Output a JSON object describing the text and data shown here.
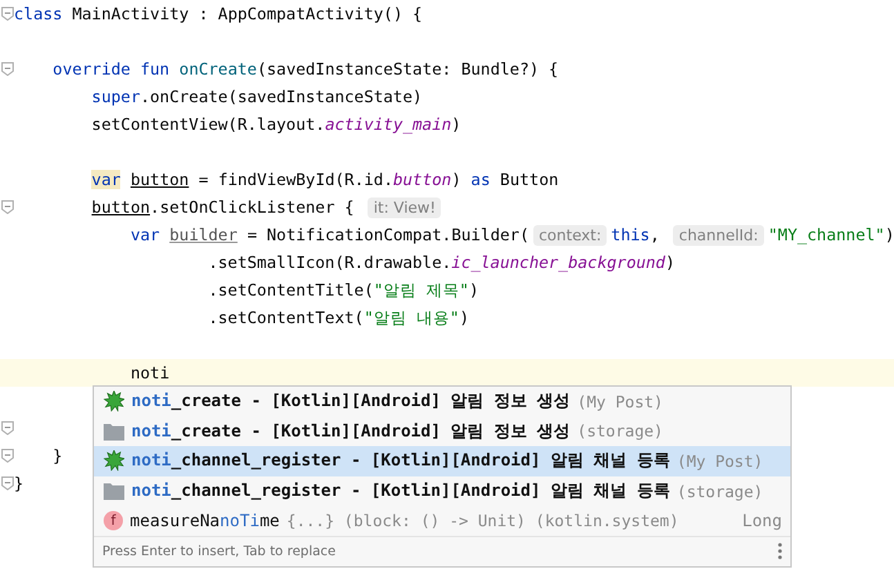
{
  "editor": {
    "lines": [
      {
        "fold": true,
        "current": false,
        "tokens": [
          {
            "text": "class",
            "kind": "kw"
          },
          {
            "text": " MainActivity : AppCompatActivity() {",
            "kind": "plain"
          }
        ]
      },
      {
        "fold": false,
        "current": false
      },
      {
        "fold": true,
        "current": false,
        "tokens": [
          {
            "text": "    override fun",
            "kind": "kw"
          },
          {
            "text": " onCreate",
            "kind": "fn"
          },
          {
            "text": "(savedInstanceState: Bundle?) {",
            "kind": "plain"
          }
        ]
      },
      {
        "fold": false,
        "current": false,
        "tokens": [
          {
            "text": "        super",
            "kind": "kw"
          },
          {
            "text": ".onCreate(savedInstanceState)",
            "kind": "plain"
          }
        ]
      },
      {
        "fold": false,
        "current": false,
        "tokens": [
          {
            "text": "        setContentView(R.layout.",
            "kind": "plain"
          },
          {
            "text": "activity_main",
            "kind": "field"
          },
          {
            "text": ")",
            "kind": "plain"
          }
        ]
      },
      {
        "fold": false,
        "current": false
      },
      {
        "fold": false,
        "current": false,
        "tokens": [
          {
            "text": "        var",
            "kind": "kw-marked"
          },
          {
            "text": " button",
            "kind": "var"
          },
          {
            "text": " = findViewById(R.id.",
            "kind": "plain"
          },
          {
            "text": "button",
            "kind": "field"
          },
          {
            "text": ") ",
            "kind": "plain"
          },
          {
            "text": "as",
            "kind": "kw"
          },
          {
            "text": " Button",
            "kind": "plain"
          }
        ]
      },
      {
        "fold": true,
        "current": false,
        "tokens": [
          {
            "text": "        button",
            "kind": "var"
          },
          {
            "text": ".setOnClickListener { ",
            "kind": "plain"
          },
          {
            "text": "it: View!",
            "kind": "hint"
          }
        ]
      },
      {
        "fold": false,
        "current": false,
        "tokens": [
          {
            "text": "            var",
            "kind": "kw"
          },
          {
            "text": " builder",
            "kind": "var-unused"
          },
          {
            "text": " = NotificationCompat.Builder(",
            "kind": "plain"
          },
          {
            "text": "context:",
            "kind": "hint"
          },
          {
            "text": "this",
            "kind": "kw"
          },
          {
            "text": ", ",
            "kind": "plain"
          },
          {
            "text": "channelId:",
            "kind": "hint"
          },
          {
            "text": "\"MY_channel\"",
            "kind": "str"
          },
          {
            "text": ")",
            "kind": "plain"
          }
        ]
      },
      {
        "fold": false,
        "current": false,
        "tokens": [
          {
            "text": "                    .setSmallIcon(R.drawable.",
            "kind": "plain"
          },
          {
            "text": "ic_launcher_background",
            "kind": "field"
          },
          {
            "text": ")",
            "kind": "plain"
          }
        ]
      },
      {
        "fold": false,
        "current": false,
        "tokens": [
          {
            "text": "                    .setContentTitle(",
            "kind": "plain"
          },
          {
            "text": "\"알림 제목\"",
            "kind": "str"
          },
          {
            "text": ")",
            "kind": "plain"
          }
        ]
      },
      {
        "fold": false,
        "current": false,
        "tokens": [
          {
            "text": "                    .setContentText(",
            "kind": "plain"
          },
          {
            "text": "\"알림 내용\"",
            "kind": "str"
          },
          {
            "text": ")",
            "kind": "plain"
          }
        ]
      },
      {
        "fold": false,
        "current": false
      },
      {
        "fold": false,
        "current": true,
        "tokens": [
          {
            "text": "            noti",
            "kind": "plain"
          }
        ]
      },
      {
        "fold": false,
        "current": false
      },
      {
        "fold": true,
        "current": false
      },
      {
        "fold": true,
        "current": false,
        "tokens": [
          {
            "text": "    }",
            "kind": "plain"
          }
        ]
      },
      {
        "fold": true,
        "current": false,
        "tokens": [
          {
            "text": "}",
            "kind": "plain"
          }
        ]
      }
    ]
  },
  "completion": {
    "items": [
      {
        "kind": "template",
        "selected": false,
        "name": [
          {
            "text": "noti",
            "match": true
          },
          {
            "text": "_create - [Kotlin][Android] 알림 정보 생성",
            "match": false
          }
        ],
        "detail": "(My Post)"
      },
      {
        "kind": "folder",
        "selected": false,
        "name": [
          {
            "text": "noti",
            "match": true
          },
          {
            "text": "_create - [Kotlin][Android] 알림 정보 생성",
            "match": false
          }
        ],
        "detail": "(storage)"
      },
      {
        "kind": "template",
        "selected": true,
        "name": [
          {
            "text": "noti",
            "match": true
          },
          {
            "text": "_channel_register - [Kotlin][Android] 알림 채널 등록",
            "match": false
          }
        ],
        "detail": "(My Post)"
      },
      {
        "kind": "folder",
        "selected": false,
        "name": [
          {
            "text": "noti",
            "match": true
          },
          {
            "text": "_channel_register - [Kotlin][Android] 알림 채널 등록",
            "match": false
          }
        ],
        "detail": "(storage)"
      },
      {
        "kind": "function",
        "selected": false,
        "icon_letter": "f",
        "name": [
          {
            "text": "measureNa",
            "match": false
          },
          {
            "text": "noTi",
            "match": true
          },
          {
            "text": "me",
            "match": false
          }
        ],
        "detail": "{...} (block: () -> Unit) (kotlin.system)",
        "type": "Long"
      }
    ],
    "footer": "Press Enter to insert, Tab to replace"
  }
}
